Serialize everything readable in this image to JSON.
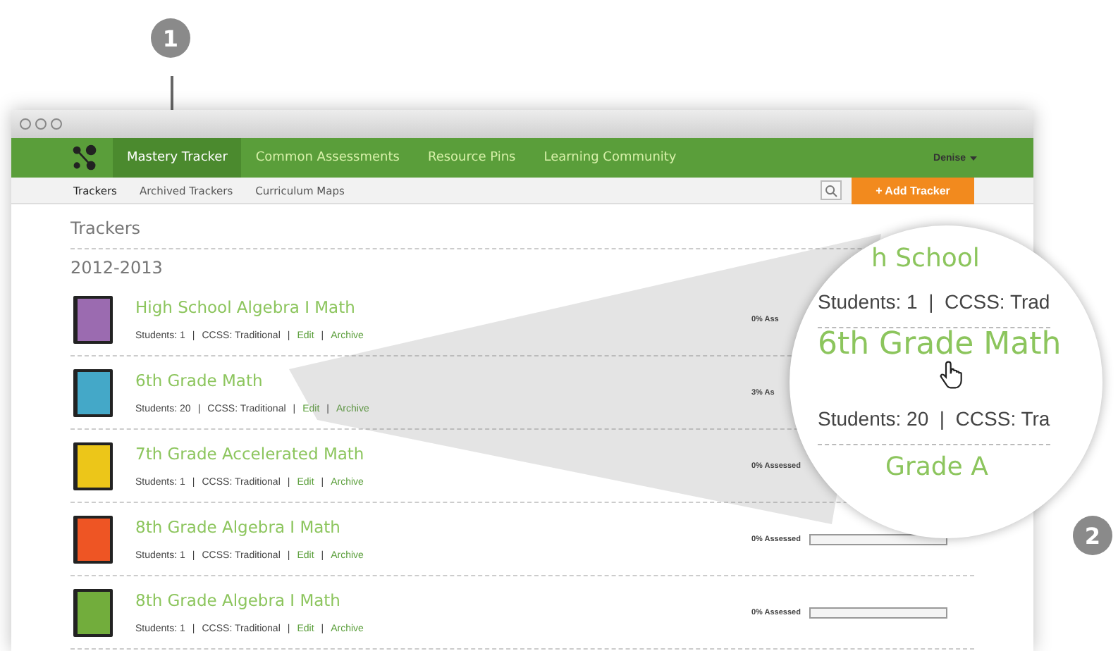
{
  "callouts": [
    {
      "number": "1"
    },
    {
      "number": "2"
    }
  ],
  "nav": {
    "items": [
      {
        "label": "Mastery Tracker",
        "selected": true
      },
      {
        "label": "Common Assessments",
        "selected": false
      },
      {
        "label": "Resource Pins",
        "selected": false
      },
      {
        "label": "Learning Community",
        "selected": false
      }
    ],
    "user": "Denise"
  },
  "subnav": {
    "tabs": [
      {
        "label": "Trackers",
        "selected": true
      },
      {
        "label": "Archived Trackers",
        "selected": false
      },
      {
        "label": "Curriculum Maps",
        "selected": false
      }
    ],
    "add_button": "+ Add Tracker"
  },
  "heading": "Trackers",
  "group": "2012-2013",
  "trackers": [
    {
      "title": "High School Algebra I Math",
      "color": "#9b6bb0",
      "meta": [
        {
          "text": "Students: 1",
          "kind": "plain"
        },
        {
          "text": "|",
          "kind": "separator"
        },
        {
          "text": "CCSS: Traditional",
          "kind": "plain"
        },
        {
          "text": "|",
          "kind": "separator"
        },
        {
          "text": "Edit",
          "kind": "link"
        },
        {
          "text": "|",
          "kind": "separator"
        },
        {
          "text": "Archive",
          "kind": "link"
        }
      ],
      "assessed": "0% Ass"
    },
    {
      "title": "6th Grade Math",
      "color": "#44a8c8",
      "meta": [
        {
          "text": "Students: 20",
          "kind": "plain"
        },
        {
          "text": "|",
          "kind": "separator"
        },
        {
          "text": "CCSS: Traditional",
          "kind": "plain"
        },
        {
          "text": "|",
          "kind": "separator"
        },
        {
          "text": "Edit",
          "kind": "link"
        },
        {
          "text": "|",
          "kind": "separator"
        },
        {
          "text": "Archive",
          "kind": "link"
        }
      ],
      "assessed": "3% As"
    },
    {
      "title": "7th Grade Accelerated Math",
      "color": "#ecc619",
      "meta": [
        {
          "text": "Students: 1",
          "kind": "plain"
        },
        {
          "text": "|",
          "kind": "separator"
        },
        {
          "text": "CCSS: Traditional",
          "kind": "plain"
        },
        {
          "text": "|",
          "kind": "separator"
        },
        {
          "text": "Edit",
          "kind": "link"
        },
        {
          "text": "|",
          "kind": "separator"
        },
        {
          "text": "Archive",
          "kind": "link"
        }
      ],
      "assessed": "0% Assessed"
    },
    {
      "title": "8th Grade Algebra I Math",
      "color": "#ee5524",
      "meta": [
        {
          "text": "Students: 1",
          "kind": "plain"
        },
        {
          "text": "|",
          "kind": "separator"
        },
        {
          "text": "CCSS: Traditional",
          "kind": "plain"
        },
        {
          "text": "|",
          "kind": "separator"
        },
        {
          "text": "Edit",
          "kind": "link"
        },
        {
          "text": "|",
          "kind": "separator"
        },
        {
          "text": "Archive",
          "kind": "link"
        }
      ],
      "assessed": "0% Assessed",
      "level": 0
    },
    {
      "title": "8th Grade Algebra I Math",
      "color": "#72ad3c",
      "meta": [
        {
          "text": "Students: 1",
          "kind": "plain"
        },
        {
          "text": "|",
          "kind": "separator"
        },
        {
          "text": "CCSS: Traditional",
          "kind": "plain"
        },
        {
          "text": "|",
          "kind": "separator"
        },
        {
          "text": "Edit",
          "kind": "link"
        },
        {
          "text": "|",
          "kind": "separator"
        },
        {
          "text": "Archive",
          "kind": "link"
        }
      ],
      "assessed": "0% Assessed",
      "level": 0
    }
  ],
  "magnifier": {
    "lines": [
      {
        "text": "h School",
        "kind": "title"
      },
      {
        "text": "Students: 1  |  CCSS: Trad",
        "kind": "meta"
      },
      {
        "text": "6th Grade Math",
        "kind": "title"
      },
      {
        "text": "Students: 20  |  CCSS: Tra",
        "kind": "meta"
      },
      {
        "text": "Grade A",
        "kind": "title"
      }
    ]
  }
}
